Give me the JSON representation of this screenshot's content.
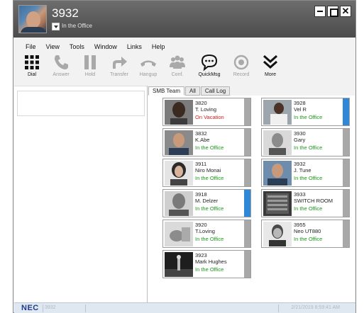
{
  "titlebar": {
    "extension": "3932",
    "status": "In the Office",
    "close_glyph": "✕"
  },
  "menu": [
    "File",
    "View",
    "Tools",
    "Window",
    "Links",
    "Help"
  ],
  "toolbar": [
    {
      "label": "Dial",
      "icon": "dialpad-icon",
      "enabled": true
    },
    {
      "label": "Answer",
      "icon": "phone-icon",
      "enabled": false
    },
    {
      "label": "Hold",
      "icon": "pause-icon",
      "enabled": false
    },
    {
      "label": "Transfer",
      "icon": "transfer-arrow-icon",
      "enabled": false
    },
    {
      "label": "Hangup",
      "icon": "hangup-icon",
      "enabled": false
    },
    {
      "label": "Conf.",
      "icon": "conference-icon",
      "enabled": false
    },
    {
      "label": "QuickMsg",
      "icon": "chat-bubble-icon",
      "enabled": true
    },
    {
      "label": "Record",
      "icon": "record-icon",
      "enabled": false
    },
    {
      "label": "More",
      "icon": "chevron-double-down-icon",
      "enabled": true
    }
  ],
  "tabs": [
    {
      "label": "SMB Team",
      "active": true
    },
    {
      "label": "All",
      "active": false
    },
    {
      "label": "Call Log",
      "active": false
    }
  ],
  "contacts": [
    {
      "ext": "3820",
      "name": "T. Loving",
      "status": "On Vacation",
      "status_color": "#d02020",
      "indicator": "#a8a8a8"
    },
    {
      "ext": "3928",
      "name": "Vel R",
      "status": "In the Office",
      "status_color": "#1a9a1a",
      "indicator": "#2f87d8"
    },
    {
      "ext": "3832",
      "name": "K.Abe",
      "status": "In the Office",
      "status_color": "#1a9a1a",
      "indicator": "#a8a8a8"
    },
    {
      "ext": "3930",
      "name": "Gary",
      "status": "In the Office",
      "status_color": "#1a9a1a",
      "indicator": "#a8a8a8"
    },
    {
      "ext": "3911",
      "name": "Niro Monai",
      "status": "In the Office",
      "status_color": "#1a9a1a",
      "indicator": "#a8a8a8"
    },
    {
      "ext": "3932",
      "name": "J. Tune",
      "status": "In the Office",
      "status_color": "#1a9a1a",
      "indicator": "#a8a8a8"
    },
    {
      "ext": "3918",
      "name": "M. Delzer",
      "status": "In the Office",
      "status_color": "#1a9a1a",
      "indicator": "#2f87d8"
    },
    {
      "ext": "3933",
      "name": "SWITCH ROOM",
      "status": "In the Office",
      "status_color": "#1a9a1a",
      "indicator": "#a8a8a8"
    },
    {
      "ext": "3920",
      "name": "T.Loving",
      "status": "In the Office",
      "status_color": "#1a9a1a",
      "indicator": "#a8a8a8"
    },
    {
      "ext": "3955",
      "name": "Neo UT880",
      "status": "In the Office",
      "status_color": "#1a9a1a",
      "indicator": "#a8a8a8"
    },
    {
      "ext": "3923",
      "name": "Mark Hughes",
      "status": "In the Office",
      "status_color": "#1a9a1a",
      "indicator": "#a8a8a8"
    }
  ],
  "statusbar": {
    "brand": "NEC",
    "extension": "3932",
    "datetime": "2/21/2019 8:59:41 AM"
  },
  "colors": {
    "titlebar": "#555555",
    "accent_blue": "#2f87d8",
    "status_green": "#1a9a1a",
    "status_red": "#d02020",
    "nec_blue": "#1d3c8a"
  }
}
